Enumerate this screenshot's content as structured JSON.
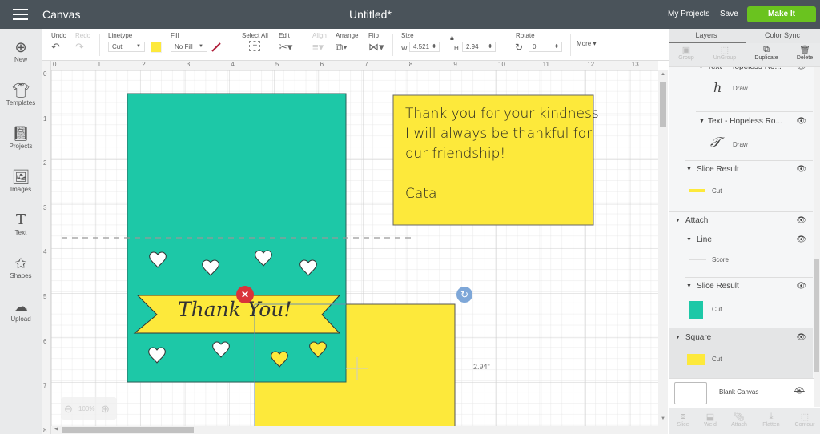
{
  "topbar": {
    "menu_icon": "hamburger-icon",
    "app_title": "Canvas",
    "doc_title": "Untitled*",
    "my_projects": "My Projects",
    "save": "Save",
    "make_it": "Make It",
    "make_it_color": "#6ac31f"
  },
  "toolbar": {
    "undo": "Undo",
    "redo": "Redo",
    "linetype_label": "Linetype",
    "linetype_value": "Cut",
    "fill_label": "Fill",
    "fill_value": "No Fill",
    "line_color": "#fde93b",
    "select_all": "Select All",
    "edit": "Edit",
    "align": "Align",
    "arrange": "Arrange",
    "flip": "Flip",
    "size_label": "Size",
    "w_label": "W",
    "w_value": "4.521",
    "h_label": "H",
    "h_value": "2.94",
    "rotate_label": "Rotate",
    "rotate_value": "0",
    "more": "More"
  },
  "leftnav": [
    {
      "label": "New",
      "icon": "plus-circle-icon"
    },
    {
      "label": "Templates",
      "icon": "tshirt-icon"
    },
    {
      "label": "Projects",
      "icon": "notebook-icon"
    },
    {
      "label": "Images",
      "icon": "image-icon"
    },
    {
      "label": "Text",
      "icon": "text-t-icon"
    },
    {
      "label": "Shapes",
      "icon": "shapes-icon"
    },
    {
      "label": "Upload",
      "icon": "cloud-upload-icon"
    }
  ],
  "rulers": {
    "top": [
      "0",
      "1",
      "2",
      "3",
      "4",
      "5",
      "6",
      "7",
      "8",
      "9",
      "10",
      "11",
      "12",
      "13"
    ],
    "left": [
      "0",
      "1",
      "2",
      "3",
      "4",
      "5",
      "6",
      "7",
      "8"
    ]
  },
  "canvas": {
    "note_lines": [
      "Thank you for your kindness",
      "I will always be thankful for",
      "our friendship!",
      "",
      "Cata"
    ],
    "banner_text": "Thank You!",
    "dimension_label": "2.94\"",
    "zoom_level": "100%",
    "colors": {
      "teal": "#1dc8a7",
      "yellow": "#fde93b",
      "delete_red": "#d9343a",
      "rotate_blue": "#7ea7d8"
    }
  },
  "rpanel": {
    "tabs": [
      "Layers",
      "Color Sync"
    ],
    "actions": [
      {
        "label": "Group",
        "enabled": false
      },
      {
        "label": "UnGroup",
        "enabled": false
      },
      {
        "label": "Duplicate",
        "enabled": true
      },
      {
        "label": "Delete",
        "enabled": true
      }
    ],
    "layers": {
      "text1": "Text - Hopeless Ro...",
      "text1_op": "Draw",
      "text2": "Text - Hopeless Ro...",
      "text2_op": "Draw",
      "slice1": "Slice Result",
      "slice1_op": "Cut",
      "attach": "Attach",
      "line": "Line",
      "line_op": "Score",
      "slice2": "Slice Result",
      "slice2_op": "Cut",
      "square": "Square",
      "square_op": "Cut"
    },
    "blank_canvas": "Blank Canvas",
    "bottom_actions": [
      "Slice",
      "Weld",
      "Attach",
      "Flatten",
      "Contour"
    ]
  }
}
